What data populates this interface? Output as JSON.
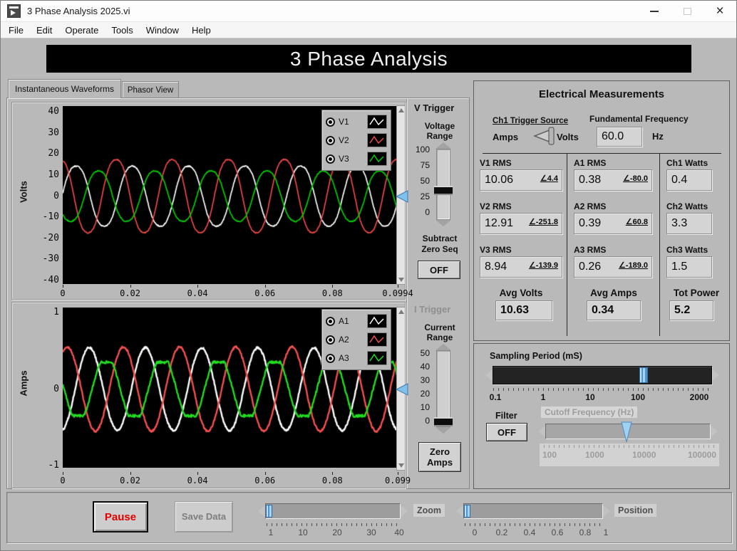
{
  "window": {
    "title": "3 Phase Analysis 2025.vi"
  },
  "menu": {
    "items": [
      "File",
      "Edit",
      "Operate",
      "Tools",
      "Window",
      "Help"
    ]
  },
  "banner": {
    "title": "3 Phase Analysis"
  },
  "tabs": {
    "instantaneous": "Instantaneous Waveforms",
    "phasor": "Phasor View"
  },
  "v_trigger": {
    "title": "V Trigger",
    "range_label": "Voltage Range",
    "scale": [
      "100",
      "75",
      "50",
      "25",
      "0"
    ],
    "value": 40,
    "handle_fraction": 0.4,
    "subtract_label": "Subtract Zero Seq",
    "button": "OFF"
  },
  "i_trigger": {
    "title": "I Trigger",
    "range_label": "Current Range",
    "scale": [
      "50",
      "40",
      "30",
      "20",
      "10",
      "0"
    ],
    "value": 0,
    "handle_fraction": 0.0,
    "button": "Zero Amps"
  },
  "measurements": {
    "title": "Electrical Measurements",
    "trigger_source": {
      "label": "Ch1 Trigger Source",
      "left": "Amps",
      "right": "Volts"
    },
    "fundamental": {
      "label": "Fundamental Frequency",
      "value": "60.0",
      "unit": "Hz"
    },
    "rms": [
      {
        "label": "V1 RMS",
        "value": "10.06",
        "angle": "∠4.4"
      },
      {
        "label": "V2 RMS",
        "value": "12.91",
        "angle": "∠-251.8"
      },
      {
        "label": "V3 RMS",
        "value": "8.94",
        "angle": "∠-139.9"
      },
      {
        "label": "A1 RMS",
        "value": "0.38",
        "angle": "∠-80.0"
      },
      {
        "label": "A2 RMS",
        "value": "0.39",
        "angle": "∠60.8"
      },
      {
        "label": "A3 RMS",
        "value": "0.26",
        "angle": "∠-189.0"
      }
    ],
    "watts": [
      {
        "label": "Ch1 Watts",
        "value": "0.4"
      },
      {
        "label": "Ch2 Watts",
        "value": "3.3"
      },
      {
        "label": "Ch3 Watts",
        "value": "1.5"
      }
    ],
    "avg_volts": {
      "label": "Avg Volts",
      "value": "10.63"
    },
    "avg_amps": {
      "label": "Avg Amps",
      "value": "0.34"
    },
    "tot_power": {
      "label": "Tot Power",
      "value": "5.2"
    }
  },
  "sampling": {
    "label": "Sampling Period (mS)",
    "scale": [
      "0.1",
      "1",
      "10",
      "100",
      "2000"
    ],
    "value": 100,
    "handle_fraction": 0.6975
  },
  "filter": {
    "label": "Filter",
    "button": "OFF"
  },
  "cutoff": {
    "label": "Cutoff Frequency (Hz)",
    "scale": [
      "100",
      "1000",
      "10000",
      "100000"
    ],
    "pointer_fraction": 0.49
  },
  "bottom": {
    "pause": "Pause",
    "save": "Save Data",
    "zoom": {
      "label": "Zoom",
      "scale": [
        "1",
        "10",
        "20",
        "30",
        "40"
      ],
      "value": 1,
      "handle_fraction": 0.0
    },
    "position": {
      "label": "Position",
      "scale": [
        "0",
        "0.2",
        "0.4",
        "0.6",
        "0.8",
        "1"
      ],
      "value": 0,
      "handle_fraction": 0.0
    }
  },
  "chart_data": [
    {
      "type": "line",
      "title": "Instantaneous Voltage Waveforms",
      "ylabel": "Volts",
      "xlabel": "",
      "ylim": [
        -40,
        40
      ],
      "yticks": [
        "40",
        "30",
        "20",
        "10",
        "0",
        "-10",
        "-20",
        "-30",
        "-40"
      ],
      "xlim": [
        0,
        0.0994
      ],
      "xtick_values": [
        0,
        0.02,
        0.04,
        0.06,
        0.08,
        0.0994
      ],
      "xtick_labels": [
        "0",
        "0.02",
        "0.04",
        "0.06",
        "0.08",
        "0.0994"
      ],
      "grid": false,
      "plot_bg": "#000000",
      "legend_position": "top-right",
      "line_width": 1.7,
      "waveform": "sine",
      "frequency_hz": 60,
      "legend": [
        {
          "name": "V1",
          "color": "#ffffff"
        },
        {
          "name": "V2",
          "color": "#f04848"
        },
        {
          "name": "V3",
          "color": "#00d000"
        }
      ],
      "series": [
        {
          "name": "V1",
          "color": "#ffffff",
          "amplitude": 15.0,
          "phase_deg": 4.4,
          "harmonic3": 0.05,
          "noise": 0.25,
          "clip": null
        },
        {
          "name": "V2",
          "color": "#f04848",
          "amplitude": 18.3,
          "phase_deg": 108.2,
          "harmonic3": 0.05,
          "noise": 0.25,
          "clip": null
        },
        {
          "name": "V3",
          "color": "#00d000",
          "amplitude": 12.6,
          "phase_deg": -139.9,
          "harmonic3": 0.05,
          "noise": 0.25,
          "clip": null
        }
      ],
      "trigger_marker": {
        "value": 0,
        "color": "#7fc1ea"
      }
    },
    {
      "type": "line",
      "title": "Instantaneous Current Waveforms",
      "ylabel": "Amps",
      "xlabel": "",
      "ylim": [
        -1,
        1
      ],
      "yticks": [
        "1",
        "0",
        "-1"
      ],
      "xlim": [
        0,
        0.0994
      ],
      "xtick_values": [
        0,
        0.02,
        0.04,
        0.06,
        0.08,
        0.0994
      ],
      "xtick_labels": [
        "0",
        "0.02",
        "0.04",
        "0.06",
        "0.08",
        "0.099"
      ],
      "grid": false,
      "plot_bg": "#000000",
      "legend_position": "top-right",
      "line_width": 2.4,
      "waveform": "sine",
      "frequency_hz": 60,
      "legend": [
        {
          "name": "A1",
          "color": "#ffffff"
        },
        {
          "name": "A2",
          "color": "#f35050"
        },
        {
          "name": "A3",
          "color": "#22dd22"
        }
      ],
      "series": [
        {
          "name": "A1",
          "color": "#ffffff",
          "amplitude": 0.54,
          "phase_deg": -80.0,
          "harmonic3": 0,
          "noise": 0.013,
          "clip": null
        },
        {
          "name": "A2",
          "color": "#f35050",
          "amplitude": 0.55,
          "phase_deg": 60.8,
          "harmonic3": 0,
          "noise": 0.013,
          "clip": null
        },
        {
          "name": "A3",
          "color": "#22dd22",
          "amplitude": 0.44,
          "phase_deg": -189.0,
          "harmonic3": 0,
          "noise": 0.016,
          "clip": 0.35
        }
      ],
      "trigger_marker": {
        "value": 0,
        "color": "#7fc1ea"
      }
    }
  ]
}
